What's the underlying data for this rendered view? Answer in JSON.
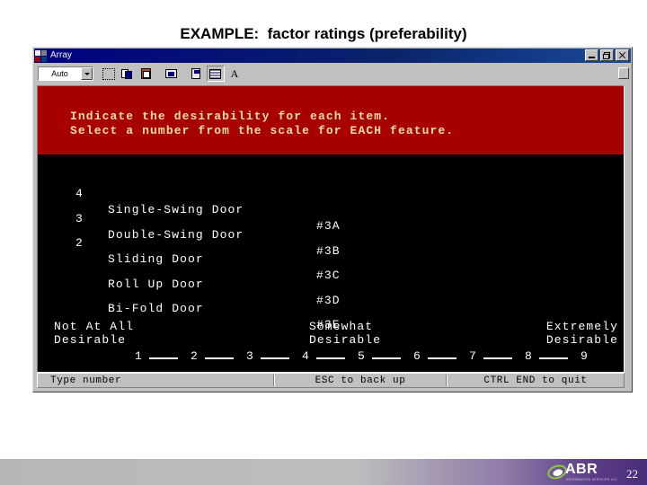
{
  "slide": {
    "title": "EXAMPLE:  factor ratings (preferability)",
    "page_number": "22"
  },
  "window": {
    "title": "Array",
    "icon": "dos-app-icon",
    "controls": {
      "minimize": "_",
      "restore": "❐",
      "close": "×"
    }
  },
  "toolbar": {
    "font_size_value": "Auto",
    "buttons": [
      {
        "name": "mark-button",
        "icon": "mark-icon"
      },
      {
        "name": "copy-button",
        "icon": "copy-icon"
      },
      {
        "name": "paste-button",
        "icon": "paste-icon"
      },
      {
        "name": "full-screen-button",
        "icon": "full-screen-icon"
      },
      {
        "name": "properties-button",
        "icon": "properties-icon"
      },
      {
        "name": "background-button",
        "icon": "background-icon"
      },
      {
        "name": "font-button",
        "icon": "font-a-icon",
        "glyph": "A"
      }
    ]
  },
  "console": {
    "banner": {
      "line1": "Indicate the desirability for each item.",
      "line2": "Select a number from the scale for EACH feature."
    },
    "items": [
      {
        "value": "4",
        "label": "Single-Swing Door",
        "code": "#3A"
      },
      {
        "value": "3",
        "label": "Double-Swing Door",
        "code": "#3B"
      },
      {
        "value": "2",
        "label": "Sliding Door",
        "code": "#3C"
      },
      {
        "value": "",
        "label": "Roll Up Door",
        "code": "#3D"
      },
      {
        "value": "",
        "label": "Bi-Fold Door",
        "code": "#3E"
      }
    ],
    "scale": {
      "anchor_left": "Not At All\nDesirable",
      "anchor_mid": "Somewhat\nDesirable",
      "anchor_right": "Extremely\nDesirable",
      "ticks": [
        "1",
        "2",
        "3",
        "4",
        "5",
        "6",
        "7",
        "8",
        "9"
      ]
    }
  },
  "statusbar": {
    "left": "Type number",
    "center": "ESC to back up",
    "right": "CTRL END to quit"
  },
  "brand": {
    "name": "ABR",
    "tagline": "INFORMATION SERVICES LLC"
  },
  "colors": {
    "banner_red": "#a80000",
    "banner_text": "#f0e0a0",
    "console_bg": "#000000",
    "console_text": "#ffffff",
    "titlebar_blue": "#000080",
    "chrome_gray": "#c0c0c0",
    "brand_purple": "#4a2d78",
    "brand_green": "#8ec63f"
  }
}
